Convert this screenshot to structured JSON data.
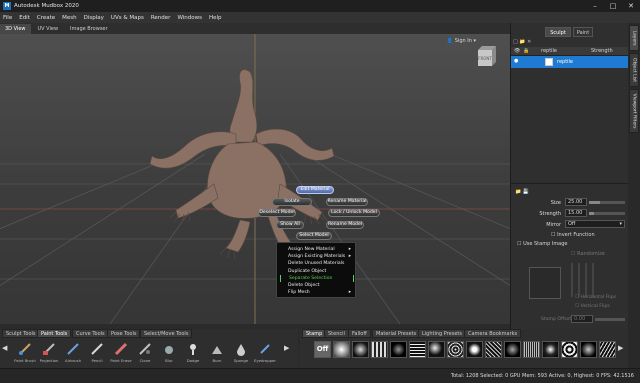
{
  "window": {
    "title": "Autodesk Mudbox 2020"
  },
  "menu": [
    "File",
    "Edit",
    "Create",
    "Mesh",
    "Display",
    "UVs & Maps",
    "Render",
    "Windows",
    "Help"
  ],
  "view_tabs": [
    "3D View",
    "UV View",
    "Image Browser"
  ],
  "viewport": {
    "sign_in": "Sign In",
    "nav_cube_label": "FRONT",
    "pie_menu": [
      "Edit Material",
      "Isolate",
      "Rename Material",
      "Deselect Model",
      "Lock / Unlock Model",
      "Show All",
      "Rename Model",
      "Select Model"
    ],
    "context_menu": [
      "Assign New Material",
      "Assign Existing Materials",
      "Delete Unused Materials",
      "Duplicate Object",
      "Separate Selection",
      "Delete Object",
      "Flip Mesh"
    ],
    "highlighted_item": "Separate Selection"
  },
  "right_panel": {
    "tabs": [
      "Sculpt",
      "Paint"
    ],
    "side_tabs": [
      "Layers",
      "Object List",
      "Viewport Filters"
    ],
    "layers_header": {
      "name": "reptile",
      "strength": "Strength"
    },
    "layer_name": "reptile",
    "props": {
      "size_label": "Size",
      "size_value": "25.00",
      "strength_label": "Strength",
      "strength_value": "15.00",
      "mirror_label": "Mirror",
      "mirror_value": "Off",
      "invert": "Invert Function",
      "use_stamp": "Use Stamp Image",
      "randomize": "Randomize",
      "horizontal_flip": "Horizontal Flips",
      "vertical_flip": "Vertical Flips",
      "stamp_offset_label": "Stamp Offset",
      "stamp_offset_value": "0.00"
    }
  },
  "tool_tray": {
    "tabs": [
      "Sculpt Tools",
      "Paint Tools",
      "Curve Tools",
      "Pose Tools",
      "Select/Move Tools"
    ],
    "active_tab": "Paint Tools",
    "tools": [
      "Paint Brush",
      "Projection",
      "Airbrush",
      "Pencil",
      "Paint Erase",
      "Clone",
      "Blur",
      "Dodge",
      "Burn",
      "Sponge",
      "Eyedropper"
    ]
  },
  "stamp_tray": {
    "tabs": [
      "Stamp",
      "Stencil",
      "Falloff",
      "Material Presets",
      "Lighting Presets",
      "Camera Bookmarks"
    ],
    "active_tab": "Stamp",
    "off_label": "Off"
  },
  "status": "Total: 1208  Selected: 0  GPU Mem: 593  Active: 0, Highest: 0  FPS: 42.1516",
  "colors": {
    "selection_blue": "#1f7bd1",
    "highlight_green": "#5bd05b",
    "model_skin": "#8a7163"
  }
}
